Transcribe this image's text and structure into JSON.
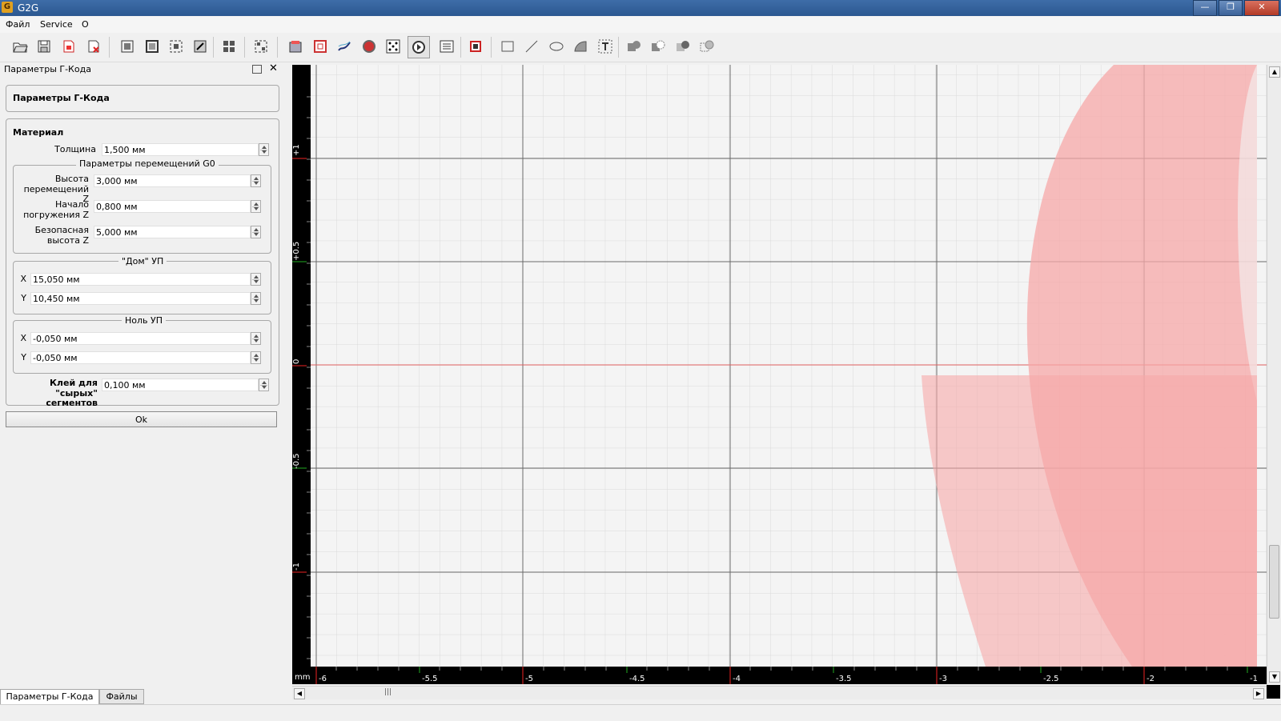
{
  "window": {
    "title": "G2G",
    "app_icon": "g2g-app-icon",
    "controls": [
      "minimize-icon",
      "restore-icon",
      "close-icon"
    ]
  },
  "menu": {
    "items": [
      "Файл",
      "Service",
      "О"
    ]
  },
  "toolbar": {
    "icons": [
      "open-folder-icon",
      "save-icon",
      "import-icon",
      "delete-icon",
      "zoom-fit-icon",
      "zoom-all-icon",
      "zoom-select-icon",
      "zoom-region-icon",
      "group-select-icon",
      "arrange-icon",
      "profile-toolpath-icon",
      "pocket-toolpath-icon",
      "raster-toolpath-icon",
      "drill-icon",
      "voronoi-icon",
      "generate-gcode-icon",
      "settings-list-icon",
      "crop-icon",
      "rectangle-icon",
      "line-icon",
      "ellipse-icon",
      "arc-icon",
      "text-icon",
      "union-icon",
      "subtract-icon",
      "intersect-icon",
      "xor-icon"
    ]
  },
  "dock": {
    "title": "Параметры Г-Кода",
    "header": "Параметры Г-Кода",
    "material": {
      "title": "Материал",
      "thickness_label": "Толщина",
      "thickness": "1,500 мм",
      "g0": {
        "title": "Параметры перемещений G0",
        "travel_label_1": "Высота",
        "travel_label_2": "перемещений Z",
        "travel": "3,000 мм",
        "plunge_label_1": "Начало",
        "plunge_label_2": "погружения Z",
        "plunge": "0,800 мм",
        "safe_label_1": "Безопасная",
        "safe_label_2": "высота Z",
        "safe": "5,000 мм"
      },
      "home": {
        "title": "\"Дом\" УП",
        "x_label": "X",
        "x": "15,050 мм",
        "y_label": "Y",
        "y": "10,450 мм"
      },
      "zero": {
        "title": "Ноль УП",
        "x_label": "X",
        "x": "-0,050 мм",
        "y_label": "Y",
        "y": "-0,050 мм"
      },
      "glue_label_1": "Клей для",
      "glue_label_2": "\"сырых\" сегментов",
      "glue": "0,100 мм"
    },
    "ok_label": "Ok",
    "tabs": [
      "Параметры Г-Кода",
      "Файлы"
    ]
  },
  "canvas": {
    "unit": "mm",
    "x_ticks": [
      "-6",
      "-5.5",
      "-5",
      "-4.5",
      "-4",
      "-3.5",
      "-3",
      "-2.5",
      "-2",
      "-1"
    ],
    "y_ticks": [
      "+1",
      "+0.5",
      "0",
      "-0.5",
      "-1"
    ]
  }
}
